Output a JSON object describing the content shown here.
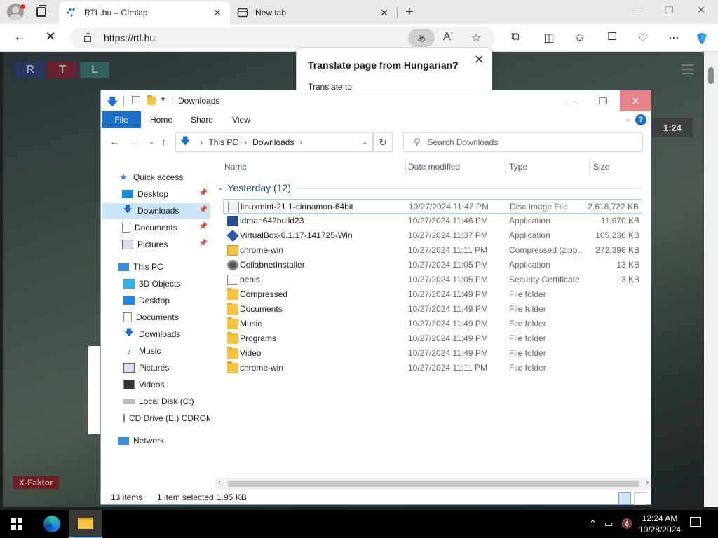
{
  "browser": {
    "tabs": [
      {
        "title": "RTL.hu – Címlap",
        "active": true
      },
      {
        "title": "New tab",
        "active": false
      }
    ],
    "url": "https://rtl.hu",
    "translate_pill": "あ",
    "read_aloud": "Aʼ"
  },
  "webpage": {
    "logo": [
      "R",
      "T",
      "L"
    ],
    "video_time": "1:24",
    "show_badge": "X-Faktor"
  },
  "translate_popup": {
    "title": "Translate page from Hungarian?",
    "subtitle": "Translate to"
  },
  "explorer": {
    "title": "Downloads",
    "ribbon_tabs": [
      "File",
      "Home",
      "Share",
      "View"
    ],
    "breadcrumb": [
      "This PC",
      "Downloads"
    ],
    "search_placeholder": "Search Downloads",
    "nav": {
      "quick_access": "Quick access",
      "quick_items": [
        "Desktop",
        "Downloads",
        "Documents",
        "Pictures"
      ],
      "this_pc": "This PC",
      "pc_items": [
        "3D Objects",
        "Desktop",
        "Documents",
        "Downloads",
        "Music",
        "Pictures",
        "Videos",
        "Local Disk (C:)",
        "CD Drive (E:) CDROM"
      ],
      "network": "Network"
    },
    "columns": {
      "name": "Name",
      "date": "Date modified",
      "type": "Type",
      "size": "Size"
    },
    "group": "Yesterday (12)",
    "files": [
      {
        "name": "linuxmint-21.1-cinnamon-64bit",
        "date": "10/27/2024 11:47 PM",
        "type": "Disc Image File",
        "size": "2,618,722 KB",
        "icon": "disc-icon"
      },
      {
        "name": "idman642build23",
        "date": "10/27/2024 11:46 PM",
        "type": "Application",
        "size": "11,970 KB",
        "icon": "app-icon"
      },
      {
        "name": "VirtualBox-6.1.17-141725-Win",
        "date": "10/27/2024 11:37 PM",
        "type": "Application",
        "size": "105,236 KB",
        "icon": "virtualbox-icon"
      },
      {
        "name": "chrome-win",
        "date": "10/27/2024 11:11 PM",
        "type": "Compressed (zipp...",
        "size": "272,396 KB",
        "icon": "zip-icon"
      },
      {
        "name": "CollabnetInstaller",
        "date": "10/27/2024 11:05 PM",
        "type": "Application",
        "size": "13 KB",
        "icon": "gear-icon"
      },
      {
        "name": "penis",
        "date": "10/27/2024 11:05 PM",
        "type": "Security Certificate",
        "size": "3 KB",
        "icon": "certificate-icon"
      },
      {
        "name": "Compressed",
        "date": "10/27/2024 11:49 PM",
        "type": "File folder",
        "size": "",
        "icon": "folder-icon"
      },
      {
        "name": "Documents",
        "date": "10/27/2024 11:49 PM",
        "type": "File folder",
        "size": "",
        "icon": "folder-icon"
      },
      {
        "name": "Music",
        "date": "10/27/2024 11:49 PM",
        "type": "File folder",
        "size": "",
        "icon": "folder-icon"
      },
      {
        "name": "Programs",
        "date": "10/27/2024 11:49 PM",
        "type": "File folder",
        "size": "",
        "icon": "folder-icon"
      },
      {
        "name": "Video",
        "date": "10/27/2024 11:49 PM",
        "type": "File folder",
        "size": "",
        "icon": "folder-icon"
      },
      {
        "name": "chrome-win",
        "date": "10/27/2024 11:11 PM",
        "type": "File folder",
        "size": "",
        "icon": "folder-icon"
      }
    ],
    "status": {
      "count": "13 items",
      "selected": "1 item selected",
      "size": "1.95 KB"
    }
  },
  "taskbar": {
    "time": "12:24 AM",
    "date": "10/28/2024"
  },
  "colors": {
    "accent": "#1d6fc5",
    "selection": "#cce4f7",
    "close_hover": "#e6828b"
  }
}
